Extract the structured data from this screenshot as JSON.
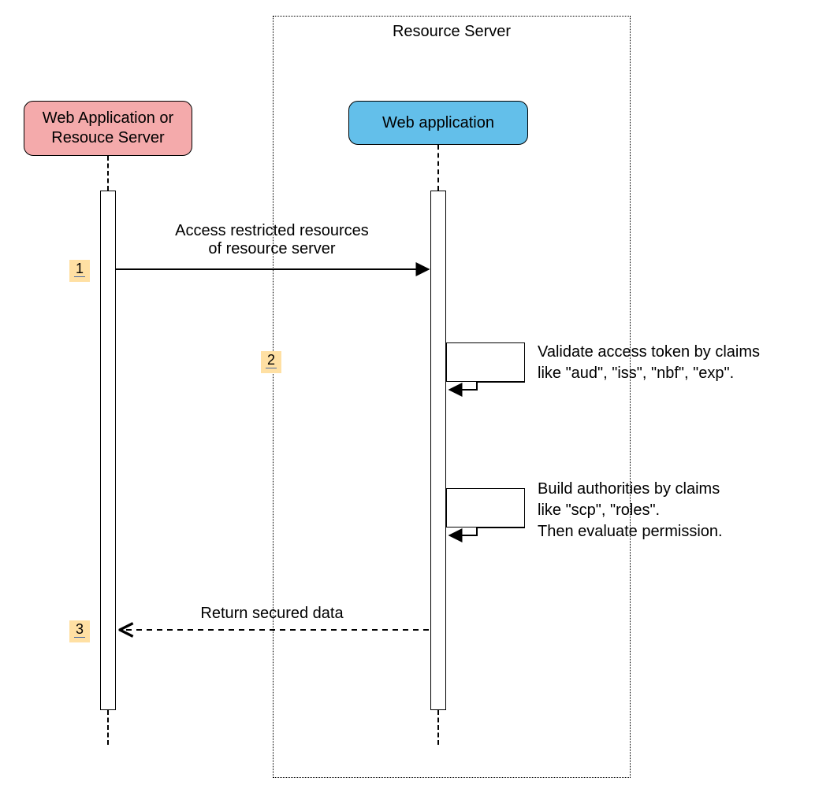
{
  "diagram": {
    "frame_title": "Resource Server",
    "actors": {
      "client": {
        "label": "Web Application or\nResouce Server"
      },
      "server": {
        "label": "Web application"
      }
    },
    "steps": {
      "s1": {
        "num": "1",
        "label_line1": "Access restricted resources",
        "label_line2": "of resource server"
      },
      "s2": {
        "num": "2",
        "note": "Validate access token by claims\nlike \"aud\", \"iss\", \"nbf\", \"exp\"."
      },
      "s2b": {
        "note": "Build authorities by claims\nlike \"scp\", \"roles\".\nThen evaluate permission."
      },
      "s3": {
        "num": "3",
        "label": "Return secured data"
      }
    }
  }
}
